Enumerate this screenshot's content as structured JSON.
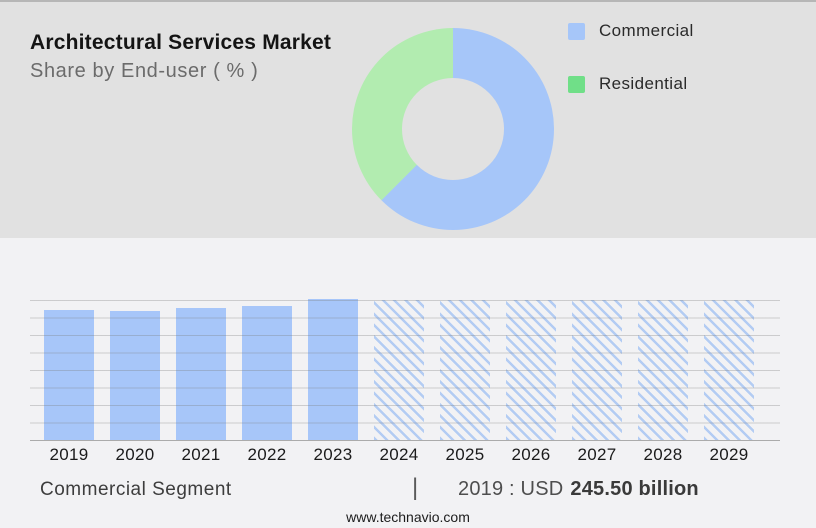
{
  "header": {
    "title": "Architectural Services Market",
    "subtitle": "Share by End-user ( % )"
  },
  "legend": {
    "items": [
      {
        "id": "commercial",
        "label": "Commercial",
        "swatch_color": "#a6c6f9"
      },
      {
        "id": "residential",
        "label": "Residential",
        "swatch_color": "#70df88"
      }
    ]
  },
  "chart_data": [
    {
      "type": "pie",
      "subtype": "donut",
      "title": "Share by End-user ( % )",
      "labels": [
        "Commercial",
        "Residential"
      ],
      "values": [
        62.5,
        37.5
      ],
      "unit": "%",
      "colors": [
        "#a6c6f9",
        "#b2ecb0"
      ],
      "start_angle_deg": 0,
      "direction": "clockwise",
      "legend_position": "right",
      "note": "No printed data labels; shares estimated from arc angles."
    },
    {
      "type": "bar",
      "categories": [
        "2019",
        "2020",
        "2021",
        "2022",
        "2023",
        "2024",
        "2025",
        "2026",
        "2027",
        "2028",
        "2029"
      ],
      "series": [
        {
          "name": "Commercial segment market size (relative height, % of forecast level; y-axis unlabeled)",
          "values": [
            93,
            92,
            94,
            96,
            101,
            100,
            100,
            100,
            100,
            100,
            100
          ]
        }
      ],
      "bar_styles": [
        "solid",
        "solid",
        "solid",
        "solid",
        "solid",
        "hatched",
        "hatched",
        "hatched",
        "hatched",
        "hatched",
        "hatched"
      ],
      "hatched_meaning": "forecast years",
      "xlabel": "",
      "ylabel": "",
      "grid": true,
      "gridline_count": 9,
      "known_point": {
        "year": "2019",
        "value": "USD 245.50 billion"
      }
    }
  ],
  "footer": {
    "segment_label": "Commercial Segment",
    "separator": "|",
    "value_prefix": "2019 : USD",
    "value_bold": "245.50 billion",
    "website": "www.technavio.com"
  },
  "colors": {
    "top_panel_bg": "#e1e1e1",
    "bottom_panel_bg": "#f2f2f4",
    "bar_blue": "#a7c6f9",
    "hatch_blue": "#b3ccf3",
    "donut_blue": "#a6c6f9",
    "donut_green": "#b2ecb0",
    "legend_green": "#70df88",
    "gridline": "#c7c7c7",
    "axis": "#ababab"
  }
}
